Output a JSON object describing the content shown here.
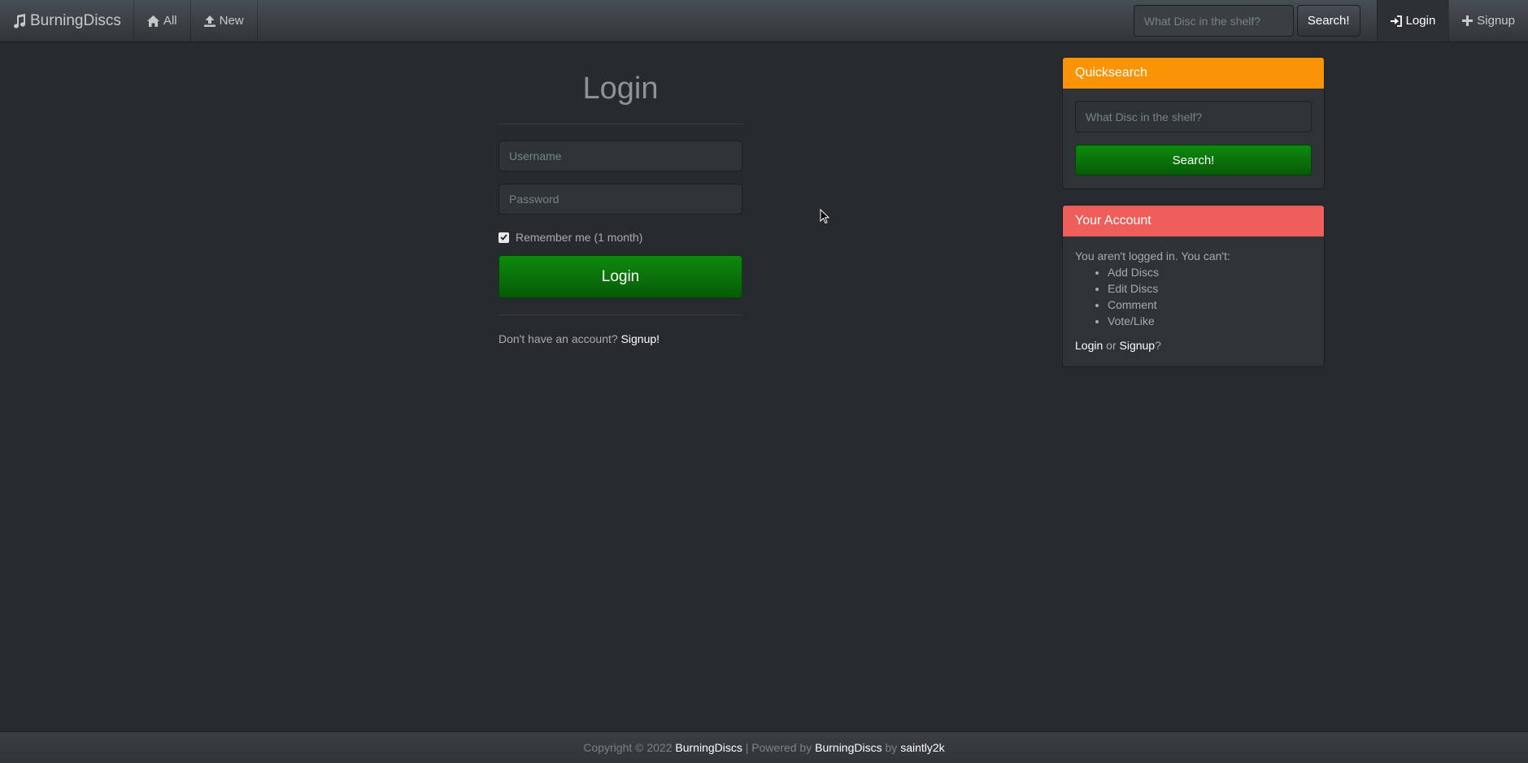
{
  "navbar": {
    "brand": "BurningDiscs",
    "items": [
      {
        "label": "All",
        "icon": "home-icon"
      },
      {
        "label": "New",
        "icon": "upload-icon"
      }
    ],
    "search": {
      "placeholder": "What Disc in the shelf?",
      "button": "Search!"
    },
    "right": [
      {
        "label": "Login",
        "icon": "login-icon"
      },
      {
        "label": "Signup",
        "icon": "plus-icon"
      }
    ]
  },
  "login": {
    "title": "Login",
    "username_placeholder": "Username",
    "password_placeholder": "Password",
    "remember_label": "Remember me (1 month)",
    "remember_checked": true,
    "button": "Login",
    "no_account_text": "Don't have an account?",
    "signup_link": "Signup!"
  },
  "quicksearch": {
    "title": "Quicksearch",
    "placeholder": "What Disc in the shelf?",
    "button": "Search!"
  },
  "account": {
    "title": "Your Account",
    "intro": "You aren't logged in. You can't:",
    "items": [
      "Add Discs",
      "Edit Discs",
      "Comment",
      "Vote/Like"
    ],
    "login_link": "Login",
    "or_text": "or",
    "signup_link": "Signup",
    "suffix": "?"
  },
  "footer": {
    "copyright": "Copyright © 2022",
    "site_link": "BurningDiscs",
    "powered_text": "| Powered by",
    "powered_link": "BurningDiscs",
    "by_text": "by",
    "author_link": "saintly2k"
  },
  "colors": {
    "background": "#272b30",
    "quicksearch_header": "#f89406",
    "account_header": "#ee5f5b",
    "primary_button": "#0a6e0a"
  }
}
